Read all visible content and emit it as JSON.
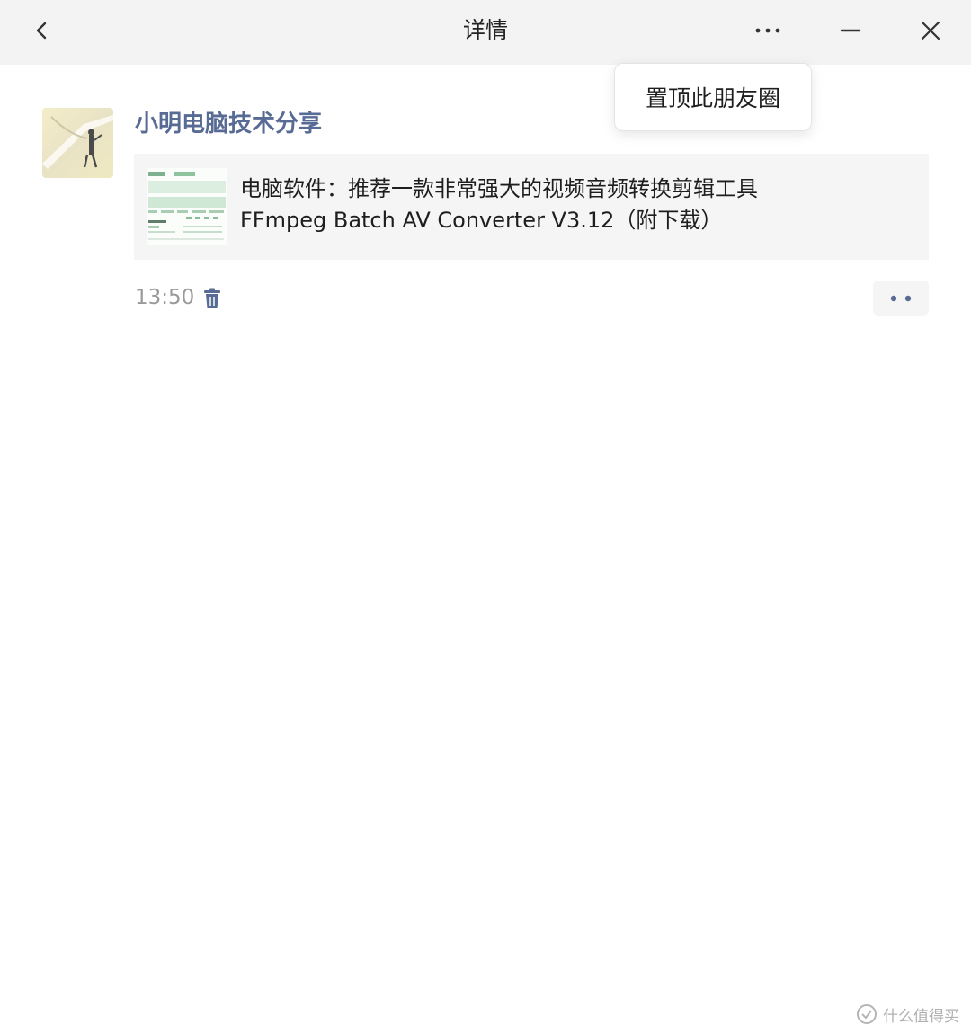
{
  "header": {
    "title": "详情"
  },
  "popup_menu": {
    "items": [
      {
        "label": "置顶此朋友圈"
      }
    ]
  },
  "post": {
    "author": "小明电脑技术分享",
    "link": {
      "title_line1": "电脑软件：推荐一款非常强大的视频音频转换剪辑工具",
      "title_line2": "FFmpeg Batch AV Converter V3.12（附下载）"
    },
    "time": "13:50"
  },
  "watermark": {
    "text": "什么值得买"
  },
  "colors": {
    "author_name": "#576b95",
    "titlebar_bg": "#f3f3f3",
    "card_bg": "#f5f5f5",
    "time_text": "#9a9a9a"
  },
  "icons": {
    "back": "chevron-left-icon",
    "more": "more-dots-icon",
    "minimize": "minimize-icon",
    "close": "close-icon",
    "delete": "trash-icon",
    "action": "two-dots-icon"
  }
}
